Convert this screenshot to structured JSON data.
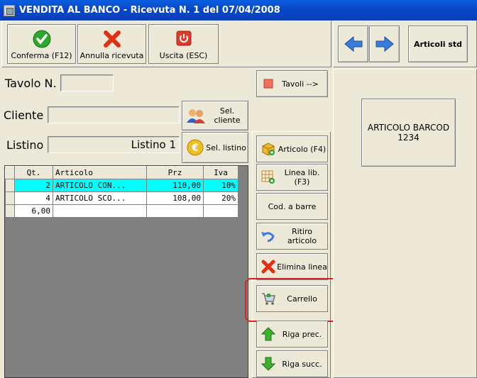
{
  "window": {
    "title": "VENDITA AL BANCO - Ricevuta N. 1 del 07/04/2008"
  },
  "toolbar": {
    "confirm": "Conferma (F12)",
    "cancel": "Annulla ricevuta",
    "exit": "Uscita (ESC)",
    "articles": "Articoli std"
  },
  "form": {
    "table_label": "Tavolo N.",
    "table_value": "",
    "client_label": "Cliente",
    "client_value": "",
    "pricelist_label": "Listino",
    "pricelist_value": "Listino 1",
    "tables_button": "Tavoli -->",
    "select_client": "Sel. cliente",
    "select_pricelist": "Sel. listino"
  },
  "grid": {
    "headers": [
      "Qt.",
      "Articolo",
      "Prz",
      "Iva"
    ],
    "rows": [
      {
        "qty": "2",
        "article": "ARTICOLO CON...",
        "price": "110,00",
        "vat": "10%",
        "selected": true
      },
      {
        "qty": "4",
        "article": "ARTICOLO SCO...",
        "price": "108,00",
        "vat": "20%",
        "selected": false
      }
    ],
    "total_qty": "6,00"
  },
  "actions": {
    "article": "Articolo (F4)",
    "free_line": "Linea lib. (F3)",
    "barcode": "Cod. a barre",
    "return": "Ritiro articolo",
    "delete_line": "Elimina linea",
    "cart": "Carrello",
    "prev_row": "Riga prec.",
    "next_row": "Riga succ."
  },
  "product_tile": {
    "line1": "ARTICOLO BARCOD",
    "line2": "1234"
  },
  "colors": {
    "title_bar": "#0a5ee0",
    "selected_row": "#00ffff",
    "highlight": "#e02020"
  }
}
